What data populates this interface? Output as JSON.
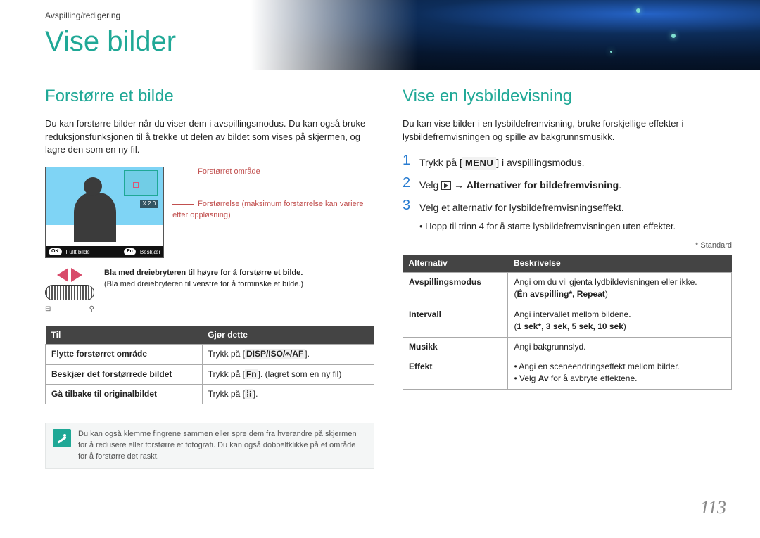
{
  "breadcrumb": "Avspilling/redigering",
  "page_title": "Vise bilder",
  "left": {
    "section_title": "Forstørre et bilde",
    "intro": "Du kan forstørre bilder når du viser dem i avspillingsmodus. Du kan også bruke reduksjonsfunksjonen til å trekke ut delen av bildet som vises på skjermen, og lagre den som en ny fil.",
    "callout1": "Forstørret område",
    "callout2": "Forstørrelse (maksimum forstørrelse kan variere etter oppløsning)",
    "zoom_label": "X 2.0",
    "footer_ok": "OK",
    "footer_full": "Fullt bilde",
    "footer_fn": "Fn",
    "footer_crop": "Beskjær",
    "scroll_bold": "Bla med dreiebryteren til høyre for å forstørre et bilde.",
    "scroll_plain": "(Bla med dreiebryteren til venstre for å forminske et bilde.)",
    "wheel_minus": "⊟",
    "wheel_plus": "⚲",
    "table": {
      "head_to": "Til",
      "head_do": "Gjør dette",
      "rows": [
        {
          "to": "Flytte forstørret område",
          "do_pre": "Trykk på [",
          "do_keys": "DISP/ISO/𝄐/AF",
          "do_post": "]."
        },
        {
          "to": "Beskjær det forstørrede bildet",
          "do_pre": "Trykk på [",
          "do_keys": "Fn",
          "do_post": "]. (lagret som en ny fil)"
        },
        {
          "to": "Gå tilbake til originalbildet",
          "do_pre": "Trykk på [",
          "do_keys": "⁞⁝",
          "do_post": "]."
        }
      ]
    },
    "note": "Du kan også klemme fingrene sammen eller spre dem fra hverandre på skjermen for å redusere eller forstørre et fotografi. Du kan også dobbeltklikke på et område for å forstørre det raskt."
  },
  "right": {
    "section_title": "Vise en lysbildevisning",
    "intro": "Du kan vise bilder i en lysbildefremvisning, bruke forskjellige effekter i lysbildefremvisningen og spille av bakgrunnsmusikk.",
    "step1_pre": "Trykk på [",
    "step1_key": "MENU",
    "step1_post": "] i avspillingsmodus.",
    "step2_pre": "Velg ",
    "step2_post": " → ",
    "step2_bold": "Alternativer for bildefremvisning",
    "step2_end": ".",
    "step3": "Velg et alternativ for lysbildefremvisningseffekt.",
    "step3_bullet": "Hopp til trinn 4 for å starte lysbildefremvisningen uten effekter.",
    "footnote": "* Standard",
    "table": {
      "head_opt": "Alternativ",
      "head_desc": "Beskrivelse",
      "rows": [
        {
          "opt": "Avspillingsmodus",
          "desc_line1": "Angi om du vil gjenta lydbildevisningen eller ikke.",
          "desc_line2_pre": "(",
          "desc_line2_bold": "Én avspilling*, Repeat",
          "desc_line2_post": ")"
        },
        {
          "opt": "Intervall",
          "desc_line1": "Angi intervallet mellom bildene.",
          "desc_line2_pre": "(",
          "desc_line2_bold": "1 sek*, 3 sek, 5 sek, 10 sek",
          "desc_line2_post": ")"
        },
        {
          "opt": "Musikk",
          "desc_line1": "Angi bakgrunnslyd.",
          "desc_line2_pre": "",
          "desc_line2_bold": "",
          "desc_line2_post": ""
        },
        {
          "opt": "Effekt",
          "desc_bullet1": "Angi en sceneendringseffekt mellom bilder.",
          "desc_bullet2_pre": "Velg ",
          "desc_bullet2_bold": "Av",
          "desc_bullet2_post": " for å avbryte effektene."
        }
      ]
    }
  },
  "page_number": "113"
}
